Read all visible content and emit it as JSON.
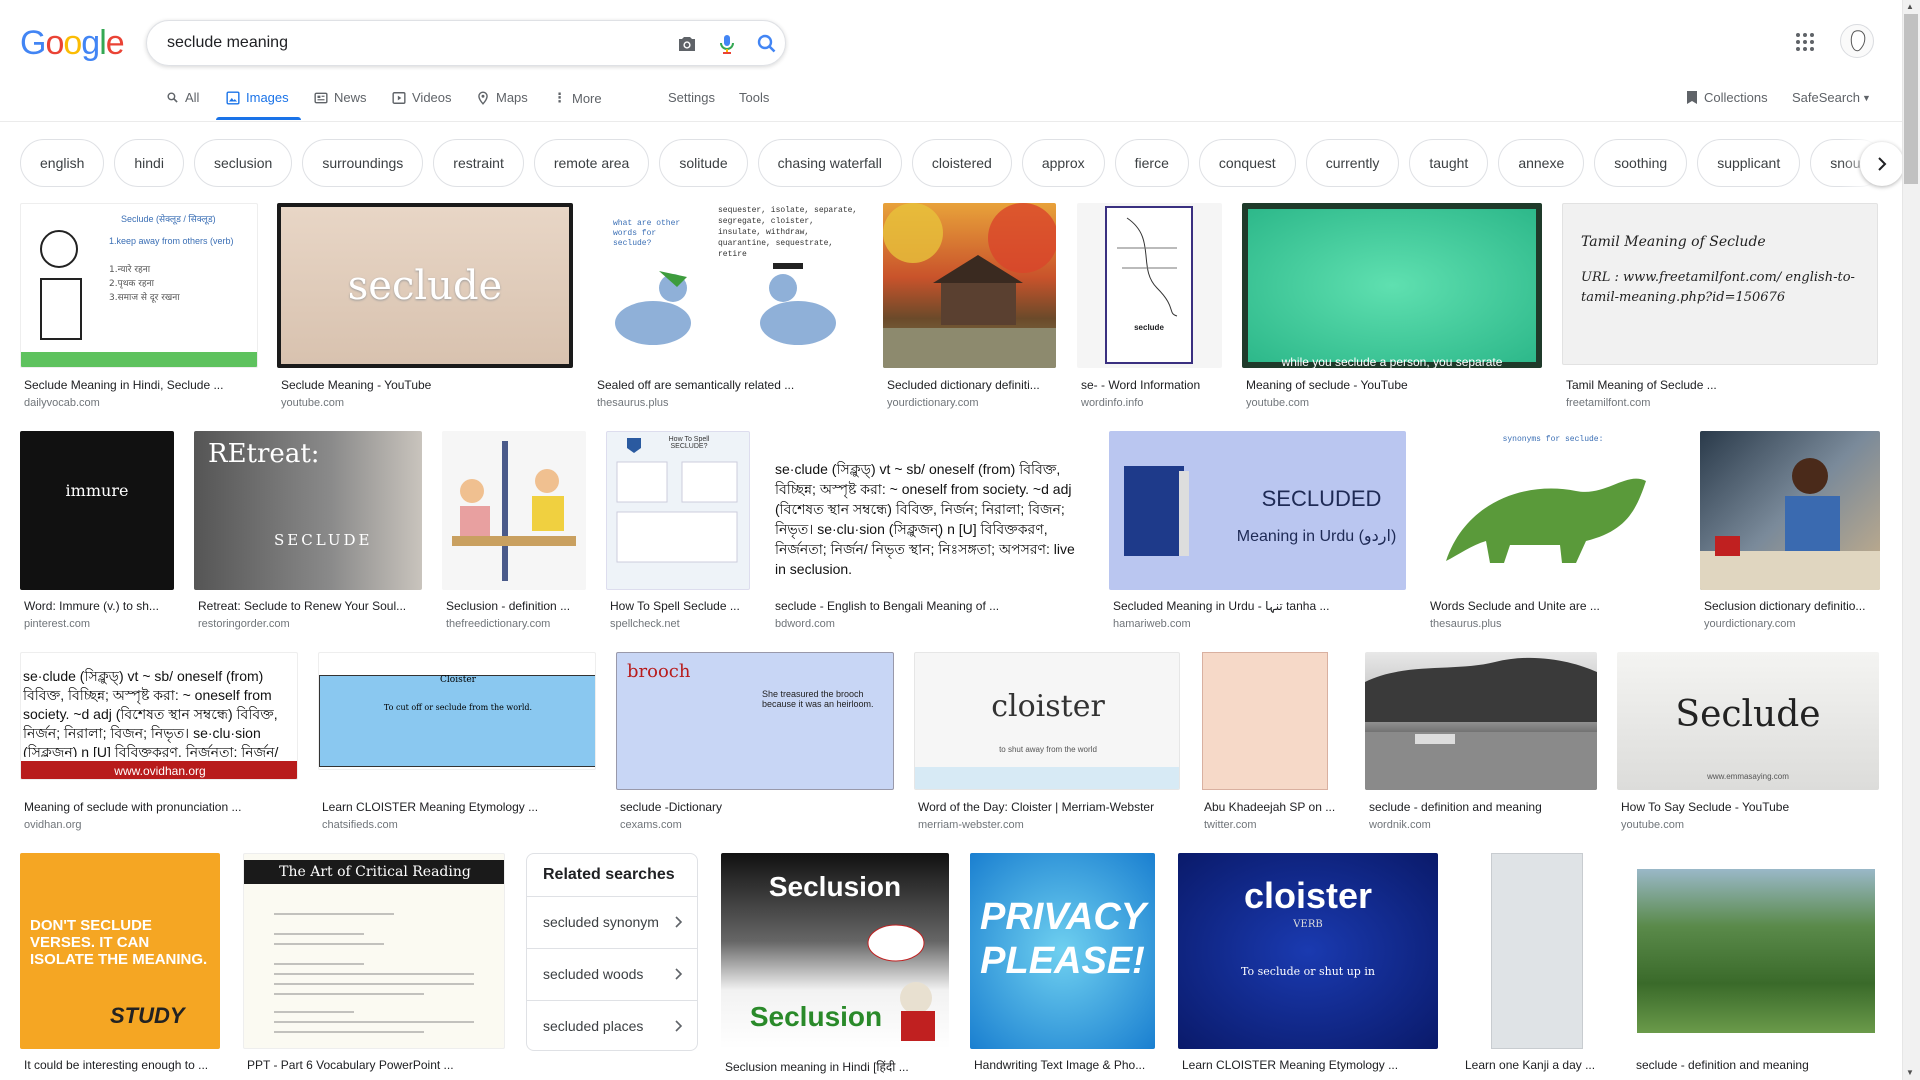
{
  "header": {
    "logo_letters": [
      {
        "ch": "G",
        "color": "#4285F4"
      },
      {
        "ch": "o",
        "color": "#EA4335"
      },
      {
        "ch": "o",
        "color": "#FBBC05"
      },
      {
        "ch": "g",
        "color": "#4285F4"
      },
      {
        "ch": "l",
        "color": "#34A853"
      },
      {
        "ch": "e",
        "color": "#EA4335"
      }
    ],
    "search_value": "seclude meaning",
    "icons": [
      "camera-icon",
      "mic-icon",
      "search-icon",
      "apps-grid-icon"
    ]
  },
  "tabs": {
    "all": "All",
    "images": "Images",
    "news": "News",
    "videos": "Videos",
    "maps": "Maps",
    "more": "More",
    "settings": "Settings",
    "tools": "Tools",
    "collections": "Collections",
    "safesearch": "SafeSearch"
  },
  "chips": [
    "english",
    "hindi",
    "seclusion",
    "surroundings",
    "restraint",
    "remote area",
    "solitude",
    "chasing waterfall",
    "cloistered",
    "approx",
    "fierce",
    "conquest",
    "currently",
    "taught",
    "annexe",
    "soothing",
    "supplicant",
    "snout"
  ],
  "results": [
    {
      "caption": "Seclude Meaning in Hindi, Seclude ...",
      "source": "dailyvocab.com",
      "thumb_text": "Seclude (सेक्लूड / सिक्लूड)"
    },
    {
      "caption": "Seclude Meaning - YouTube",
      "source": "youtube.com",
      "thumb_text": "seclude"
    },
    {
      "caption": "Sealed off are semantically related ...",
      "source": "thesaurus.plus",
      "thumb_text": "sequester, isolate, separate, segregate, cloister, insulate, withdraw, quarantine, sequestrate, retire"
    },
    {
      "caption": "Secluded dictionary definiti...",
      "source": "yourdictionary.com",
      "thumb_text": ""
    },
    {
      "caption": "se- - Word Information",
      "source": "wordinfo.info",
      "thumb_text": "seclude"
    },
    {
      "caption": "Meaning of seclude - YouTube",
      "source": "youtube.com",
      "thumb_text": "while you seclude a person, you separate"
    },
    {
      "caption": "Tamil Meaning of Seclude ...",
      "source": "freetamilfont.com",
      "thumb_text": "Tamil Meaning of Seclude",
      "thumb_text2": "URL : www.freetamilfont.com/ english-to-tamil-meaning.php?id=150676"
    },
    {
      "caption": "Word: Immure (v.) to sh...",
      "source": "pinterest.com",
      "thumb_text": "immure"
    },
    {
      "caption": "Retreat: Seclude to Renew Your Soul...",
      "source": "restoringorder.com",
      "thumb_text": "REtreat:",
      "thumb_text2": "SECLUDE"
    },
    {
      "caption": "Seclusion - definition ...",
      "source": "thefreedictionary.com",
      "thumb_text": ""
    },
    {
      "caption": "How To Spell Seclude ...",
      "source": "spellcheck.net",
      "thumb_text": "How To Spell SECLUDE?"
    },
    {
      "caption": "seclude - English to Bengali Meaning of ...",
      "source": "bdword.com",
      "thumb_text": "se·clude (সিক্লুড্) vt ~ sb/ oneself (from) বিবিক্ত, বিচ্ছিন্ন; অস্পৃষ্ট করা: ~ oneself from society. ~d adj (বিশেষত স্থান সম্বন্ধে) বিবিক্ত, নির্জন; নিরালা; বিজন; নিভৃত। se·clu·sion (সিক্লুজন্) n [U] বিবিক্তকরণ, নির্জনতা; নির্জন/ নিভৃত স্থান; নিঃসঙ্গতা; অপসরণ: live in seclusion."
    },
    {
      "caption": "Secluded Meaning in Urdu - تنہا tanha ...",
      "source": "hamariweb.com",
      "thumb_text": "SECLUDED",
      "thumb_text2": "Meaning in Urdu (اردو)"
    },
    {
      "caption": "Words Seclude and Unite are ...",
      "source": "thesaurus.plus",
      "thumb_text": "synonyms for seclude:"
    },
    {
      "caption": "Seclusion dictionary definitio...",
      "source": "yourdictionary.com",
      "thumb_text": ""
    },
    {
      "caption": "Meaning of seclude with pronunciation ...",
      "source": "ovidhan.org",
      "thumb_text": "www.ovidhan.org"
    },
    {
      "caption": "Learn CLOISTER Meaning Etymology ...",
      "source": "chatsifieds.com",
      "thumb_text": "Cloister",
      "thumb_text2": "To cut off or seclude from the world."
    },
    {
      "caption": "seclude -Dictionary",
      "source": "cexams.com",
      "thumb_text": "brooch",
      "thumb_text2": "She treasured the brooch because it was an heirloom."
    },
    {
      "caption": "Word of the Day: Cloister | Merriam-Webster",
      "source": "merriam-webster.com",
      "thumb_text": "cloister",
      "thumb_text2": "to shut away from the world"
    },
    {
      "caption": "Abu Khadeejah SP on ...",
      "source": "twitter.com",
      "thumb_text": ""
    },
    {
      "caption": "seclude - definition and meaning",
      "source": "wordnik.com",
      "thumb_text": ""
    },
    {
      "caption": "How To Say Seclude - YouTube",
      "source": "youtube.com",
      "thumb_text": "Seclude",
      "thumb_text2": "www.emmasaying.com"
    },
    {
      "caption": "It could be interesting enough to ...",
      "source": "",
      "thumb_text": "DON'T SECLUDE VERSES. IT CAN ISOLATE THE MEANING.",
      "thumb_text2": "STUDY"
    },
    {
      "caption": "PPT - Part 6 Vocabulary PowerPoint ...",
      "source": "",
      "thumb_text": "The Art of Critical Reading"
    },
    {
      "caption": "Seclusion meaning in Hindi [हिंदी ...",
      "source": "",
      "thumb_text": "Seclusion"
    },
    {
      "caption": "Handwriting Text Image & Pho...",
      "source": "",
      "thumb_text": "PRIVACY PLEASE!"
    },
    {
      "caption": "Learn CLOISTER Meaning Etymology ...",
      "source": "",
      "thumb_text": "cloister",
      "thumb_text2": "VERB",
      "thumb_text3": "To seclude or shut up in"
    },
    {
      "caption": "Learn one Kanji a day ...",
      "source": "",
      "thumb_text": ""
    },
    {
      "caption": "seclude - definition and meaning",
      "source": "",
      "thumb_text": ""
    }
  ],
  "related": {
    "title": "Related searches",
    "items": [
      "secluded synonym",
      "secluded woods",
      "secluded places"
    ]
  }
}
